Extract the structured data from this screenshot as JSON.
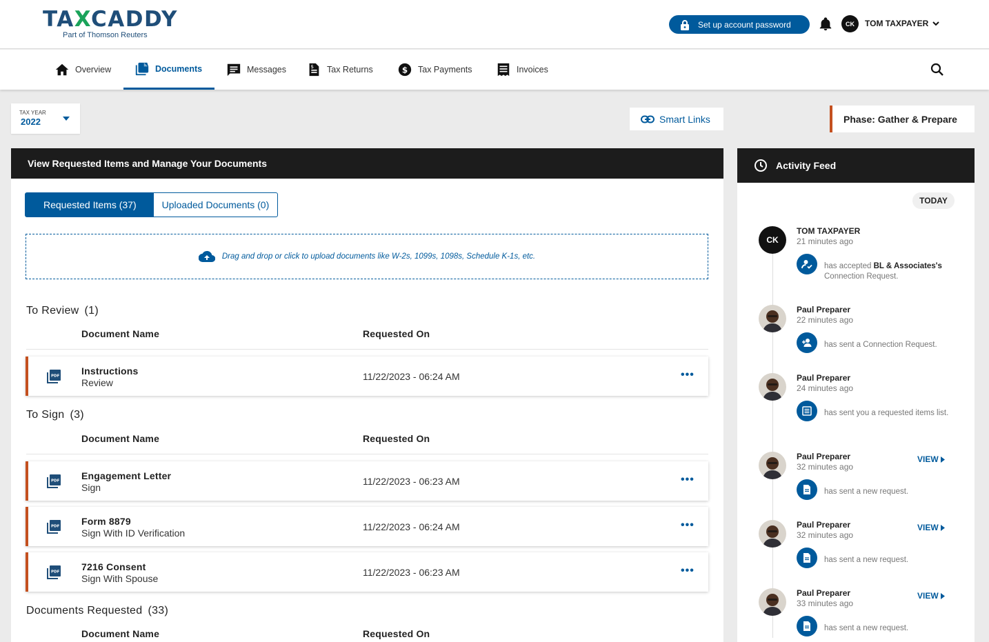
{
  "header": {
    "logo_main_left": "TA",
    "logo_main_x": "X",
    "logo_main_right": "CADDY",
    "logo_sub": "Part of Thomson Reuters",
    "password_button": "Set up account password",
    "user_initials": "CK",
    "user_name": "TOM TAXPAYER"
  },
  "nav": {
    "items": [
      {
        "label": "Overview",
        "icon": "home-icon"
      },
      {
        "label": "Documents",
        "icon": "document-icon",
        "active": true
      },
      {
        "label": "Messages",
        "icon": "message-icon"
      },
      {
        "label": "Tax Returns",
        "icon": "tax-return-icon"
      },
      {
        "label": "Tax Payments",
        "icon": "dollar-icon"
      },
      {
        "label": "Invoices",
        "icon": "invoice-icon"
      }
    ]
  },
  "controls": {
    "tax_year_label": "TAX YEAR",
    "tax_year_value": "2022",
    "smart_links": "Smart Links",
    "phase": "Phase: Gather & Prepare"
  },
  "main": {
    "title": "View Requested Items and Manage Your Documents",
    "tabs": [
      "Requested Items (37)",
      "Uploaded Documents (0)"
    ],
    "dropzone_text": "Drag and drop or click to upload documents like W-2s, 1099s, 1098s, Schedule K-1s, etc.",
    "col_name": "Document Name",
    "col_requested": "Requested On",
    "sections": [
      {
        "title": "To Review",
        "count": "(1)",
        "rows": [
          {
            "name": "Instructions",
            "sub": "Review",
            "date": "11/22/2023 - 06:24 AM"
          }
        ]
      },
      {
        "title": "To Sign",
        "count": "(3)",
        "rows": [
          {
            "name": "Engagement Letter",
            "sub": "Sign",
            "date": "11/22/2023 - 06:23 AM"
          },
          {
            "name": "Form 8879",
            "sub": "Sign With ID Verification",
            "date": "11/22/2023 - 06:24 AM"
          },
          {
            "name": "7216 Consent",
            "sub": "Sign With Spouse",
            "date": "11/22/2023 - 06:23 AM"
          }
        ]
      },
      {
        "title": "Documents Requested",
        "count": "(33)",
        "rows": []
      }
    ],
    "more_glyph": "•••"
  },
  "feed": {
    "title": "Activity Feed",
    "today": "TODAY",
    "view_label": "VIEW",
    "entries": [
      {
        "name": "TOM TAXPAYER",
        "time": "21 minutes ago",
        "text_pre": "has accepted ",
        "text_bold": "BL & Associates's",
        "text_post": " Connection Request.",
        "icon": "user-check-icon"
      },
      {
        "name": "Paul Preparer",
        "time": "22 minutes ago",
        "text": "has sent a Connection Request.",
        "icon": "user-add-icon"
      },
      {
        "name": "Paul Preparer",
        "time": "24 minutes ago",
        "text": "has sent you a requested items list.",
        "icon": "list-icon"
      },
      {
        "name": "Paul Preparer",
        "time": "32 minutes ago",
        "text": "has sent a new request.",
        "icon": "doc-icon"
      },
      {
        "name": "Paul Preparer",
        "time": "32 minutes ago",
        "text": "has sent a new request.",
        "icon": "doc-icon"
      },
      {
        "name": "Paul Preparer",
        "time": "33 minutes ago",
        "text": "has sent a new request.",
        "icon": "doc-icon"
      }
    ]
  },
  "colors": {
    "brand_blue": "#005a9c",
    "accent_orange": "#c4501f",
    "logo_green": "#1aa35a",
    "dark_header": "#1c1c1c"
  }
}
